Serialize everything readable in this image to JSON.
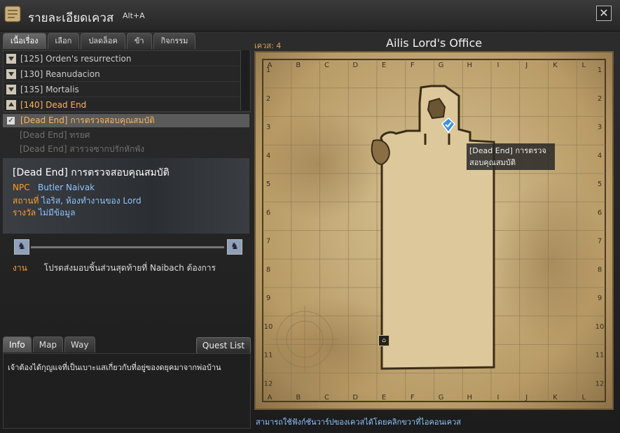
{
  "window": {
    "title": "รายละเอียดเควส",
    "hotkey": "Alt+A",
    "close_label": "✕"
  },
  "tabs": [
    "เนื้อเรื่อง",
    "เลือก",
    "ปลดล็อค",
    "ข้า",
    "กิจกรรม"
  ],
  "quest_list": [
    {
      "label": "[125] Orden's resurrection",
      "state": "collapsed"
    },
    {
      "label": "[130] Reanudacion",
      "state": "collapsed"
    },
    {
      "label": "[135] Mortalis",
      "state": "collapsed"
    },
    {
      "label": "[140] Dead End",
      "state": "expanded"
    }
  ],
  "sub_quests": [
    {
      "label": "[Dead End] การตรวจสอบคุณสมบัติ",
      "checked": true
    },
    {
      "label": "[Dead End] ทรยศ"
    },
    {
      "label": "[Dead End] สารวจซากปรักหักพัง"
    }
  ],
  "detail": {
    "title": "[Dead End] การตรวจสอบคุณสมบัติ",
    "npc_label": "NPC",
    "npc_value": "Butler Naivak",
    "place_label": "สถานที่",
    "place_value": "ไอริส, ห้องทำงานของ Lord",
    "reward_label": "รางวัล",
    "reward_value": "ไม่มีข้อมูล"
  },
  "task": {
    "label": "งาน",
    "text": "โปรดส่งมอบชิ้นส่วนสุดท้ายที่ Naibach ต้องการ"
  },
  "bottom_tabs": [
    "Info",
    "Map",
    "Way"
  ],
  "quest_list_button": "Quest List",
  "info_text": "เจ้าต้องได้กุญแจที่เป็นเบาะแสเกี่ยวกับที่อยู่ของดยุคมาจากพ่อบ้าน",
  "map": {
    "quest_no": "เควส: 4",
    "title": "Ailis Lord's Office",
    "columns": [
      "A",
      "B",
      "C",
      "D",
      "E",
      "F",
      "G",
      "H",
      "I",
      "J",
      "K",
      "L"
    ],
    "rows": [
      "1",
      "2",
      "3",
      "4",
      "5",
      "6",
      "7",
      "8",
      "9",
      "10",
      "11",
      "12"
    ],
    "tooltip_line1": "[Dead End] การตรวจ",
    "tooltip_line2": "สอบคุณสมบัติ",
    "hint": "สามารถใช้ฟังก์ชันวาร์ปของเควสได้โดยคลิกขวาที่ไอคอนเควส"
  }
}
